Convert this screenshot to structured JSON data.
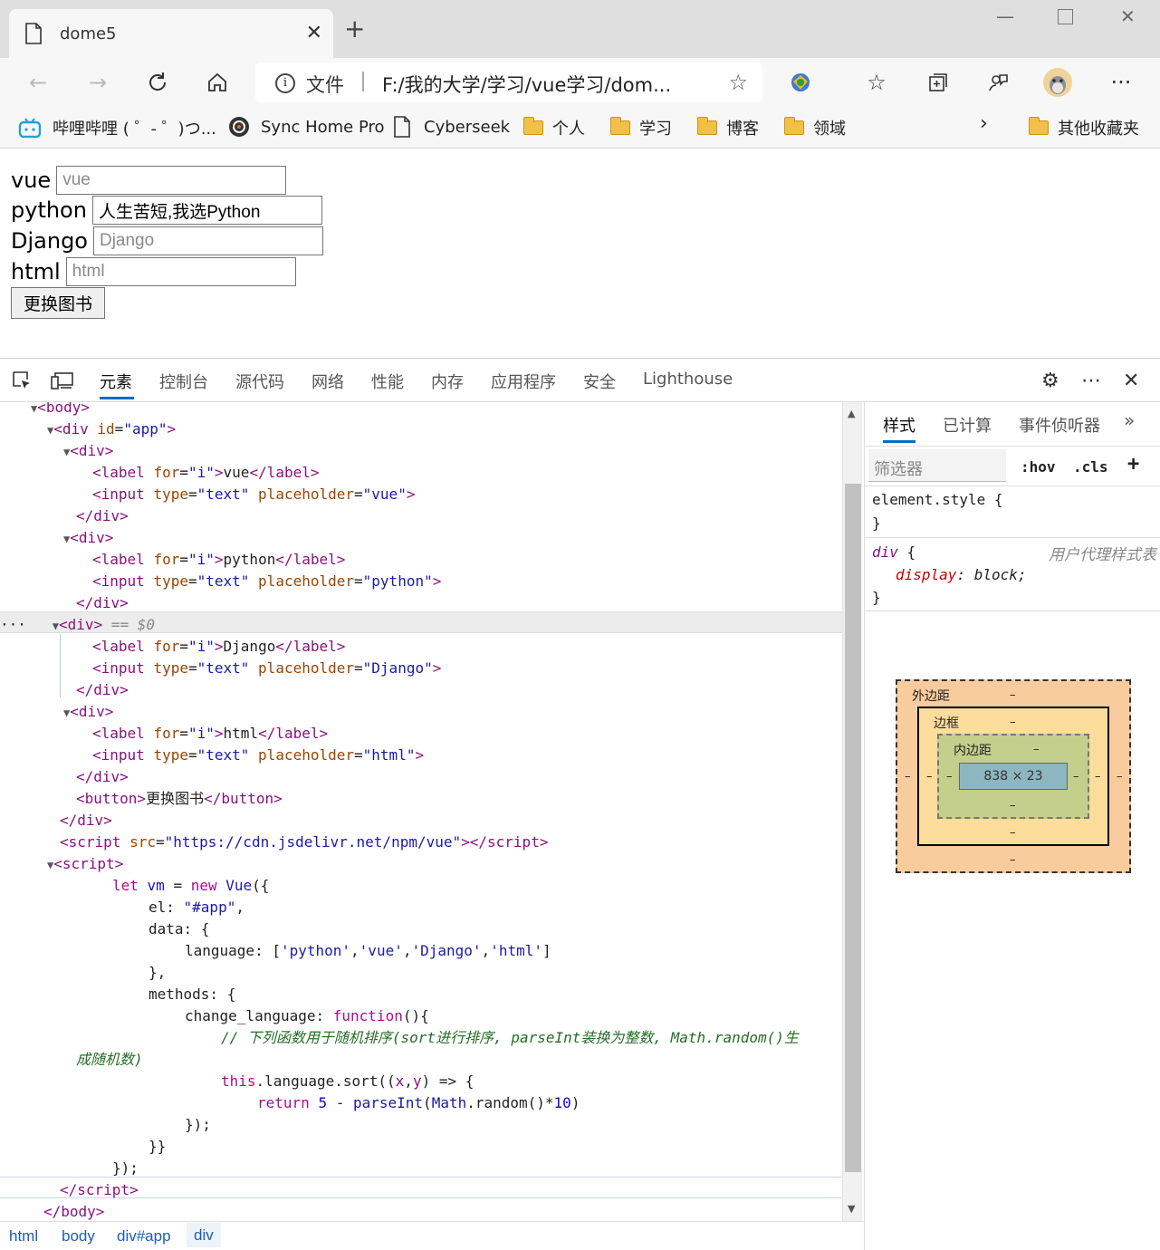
{
  "browser": {
    "tab_title": "dome5",
    "address_scheme": "文件",
    "address_url": "F:/我的大学/学习/vue学习/dom..."
  },
  "bookmarks": [
    {
      "label": "哔哩哔哩 ( ゜- ゜)つ...",
      "icon": "bilibili-icon"
    },
    {
      "label": "Sync Home Pro",
      "icon": "sync-icon"
    },
    {
      "label": "Cyberseek",
      "icon": "page-icon"
    },
    {
      "label": "个人",
      "icon": "folder-icon"
    },
    {
      "label": "学习",
      "icon": "folder-icon"
    },
    {
      "label": "博客",
      "icon": "folder-icon"
    },
    {
      "label": "领域",
      "icon": "folder-icon"
    },
    {
      "label": "其他收藏夹",
      "icon": "folder-icon"
    }
  ],
  "page": {
    "rows": [
      {
        "label": "vue",
        "value": "",
        "placeholder": "vue"
      },
      {
        "label": "python",
        "value": "人生苦短,我选Python",
        "placeholder": "python"
      },
      {
        "label": "Django",
        "value": "",
        "placeholder": "Django"
      },
      {
        "label": "html",
        "value": "",
        "placeholder": "html"
      }
    ],
    "button": "更换图书"
  },
  "devtools": {
    "tabs": [
      "元素",
      "控制台",
      "源代码",
      "网络",
      "性能",
      "内存",
      "应用程序",
      "安全",
      "Lighthouse"
    ],
    "active_tab": "元素",
    "selected_marker": "== $0",
    "breadcrumbs": [
      "html",
      "body",
      "div#app",
      "div"
    ],
    "styles_tabs": [
      "样式",
      "已计算",
      "事件侦听器"
    ],
    "filter_placeholder": "筛选器",
    "hov": ":hov",
    "cls": ".cls",
    "element_style": "element.style {",
    "close_brace": "}",
    "rule_selector": "div",
    "rule_source": "用户代理样式表",
    "rule_prop": "display",
    "rule_value": "block",
    "boxmodel": {
      "margin": "外边距",
      "border": "边框",
      "padding": "内边距",
      "content": "838 × 23",
      "dash": "–"
    }
  },
  "colors": {
    "accent": "#0f6cbd",
    "tag": "#881280",
    "attr_name": "#994500",
    "attr_value": "#1a1aa6",
    "comment": "#236e25"
  }
}
